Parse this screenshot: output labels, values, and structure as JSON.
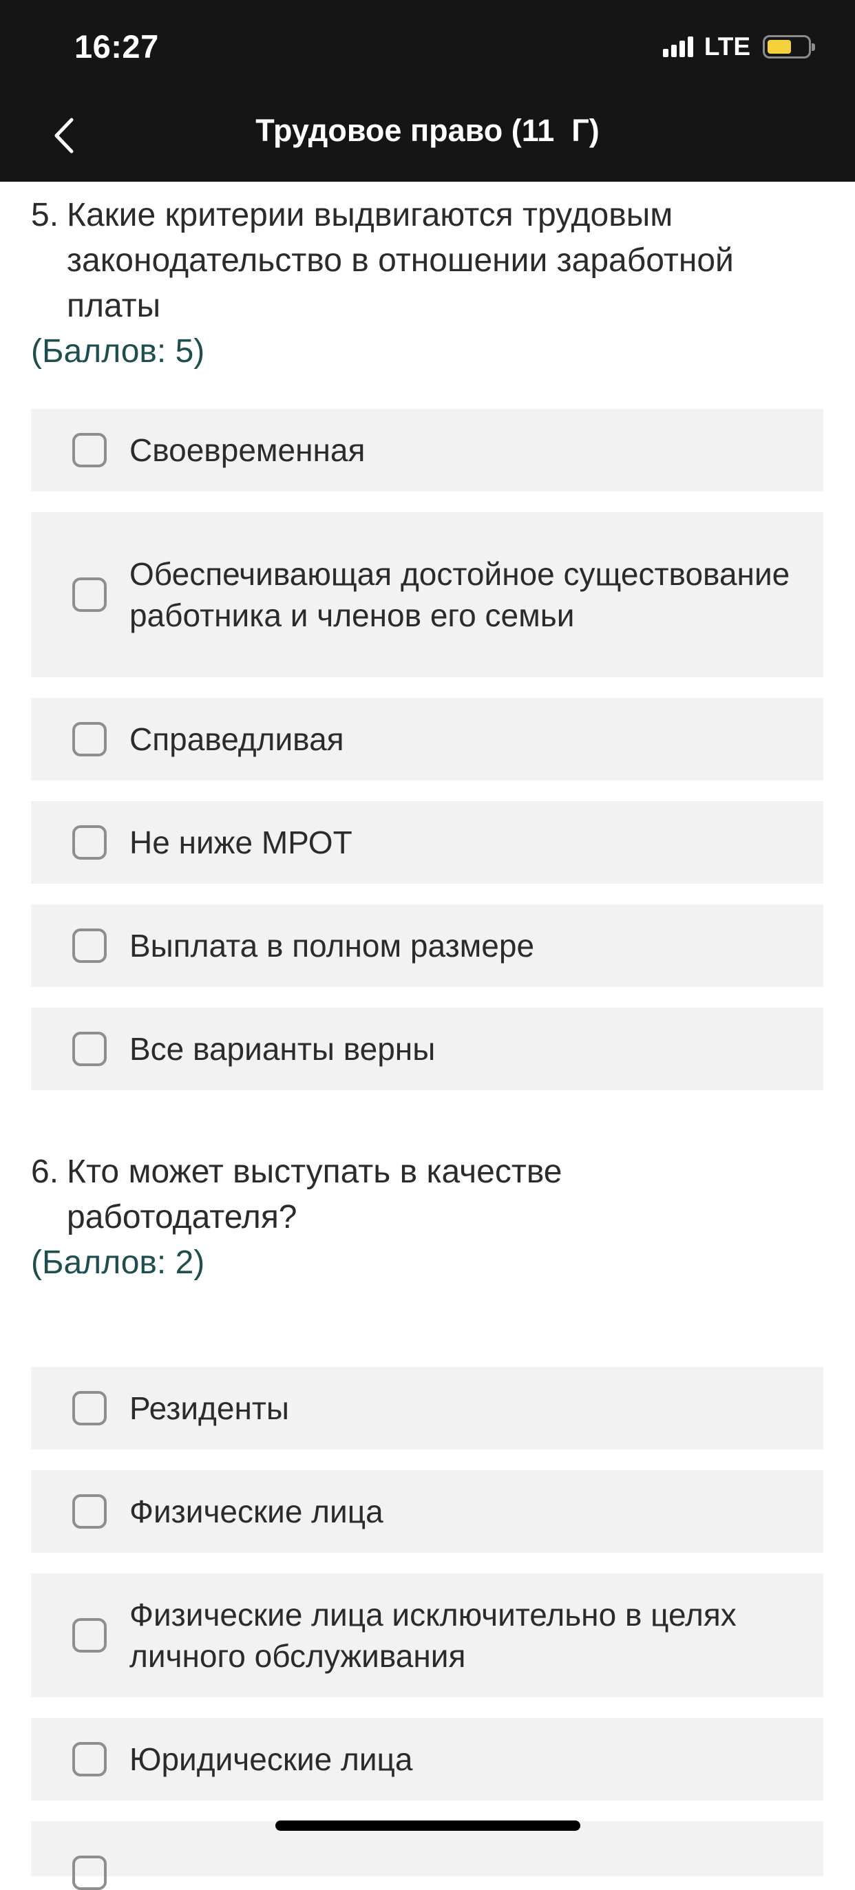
{
  "status_bar": {
    "time": "16:27",
    "network": "LTE",
    "signal_bars": 4,
    "battery_level": 0.6,
    "battery_color": "#f5d23c"
  },
  "nav": {
    "title": "Трудовое право (11  Г)",
    "back_icon": "chevron-left-icon"
  },
  "questions": [
    {
      "number": "5.",
      "text": "Какие критерии выдвигаются трудовым законодательство в отношении заработной платы",
      "points": "(Баллов: 5)",
      "options": [
        {
          "label": "Своевременная",
          "checked": false
        },
        {
          "label": "Обеспечивающая достойное существование работника и членов его семьи",
          "checked": false
        },
        {
          "label": "Справедливая",
          "checked": false
        },
        {
          "label": "Не ниже МРОТ",
          "checked": false
        },
        {
          "label": "Выплата в полном размере",
          "checked": false
        },
        {
          "label": "Все варианты верны",
          "checked": false
        }
      ]
    },
    {
      "number": "6.",
      "text": "Кто может выступать в качестве работодателя?",
      "points": "(Баллов: 2)",
      "options": [
        {
          "label": "Резиденты",
          "checked": false
        },
        {
          "label": "Физические лица",
          "checked": false
        },
        {
          "label": "Физические лица исключительно в целях личного обслуживания",
          "checked": false
        },
        {
          "label": "Юридические лица",
          "checked": false
        }
      ]
    }
  ],
  "colors": {
    "header_bg": "#151515",
    "option_bg": "#f2f2f2",
    "points_text": "#1e4e4e",
    "checkbox_border": "#8e8e8e"
  }
}
